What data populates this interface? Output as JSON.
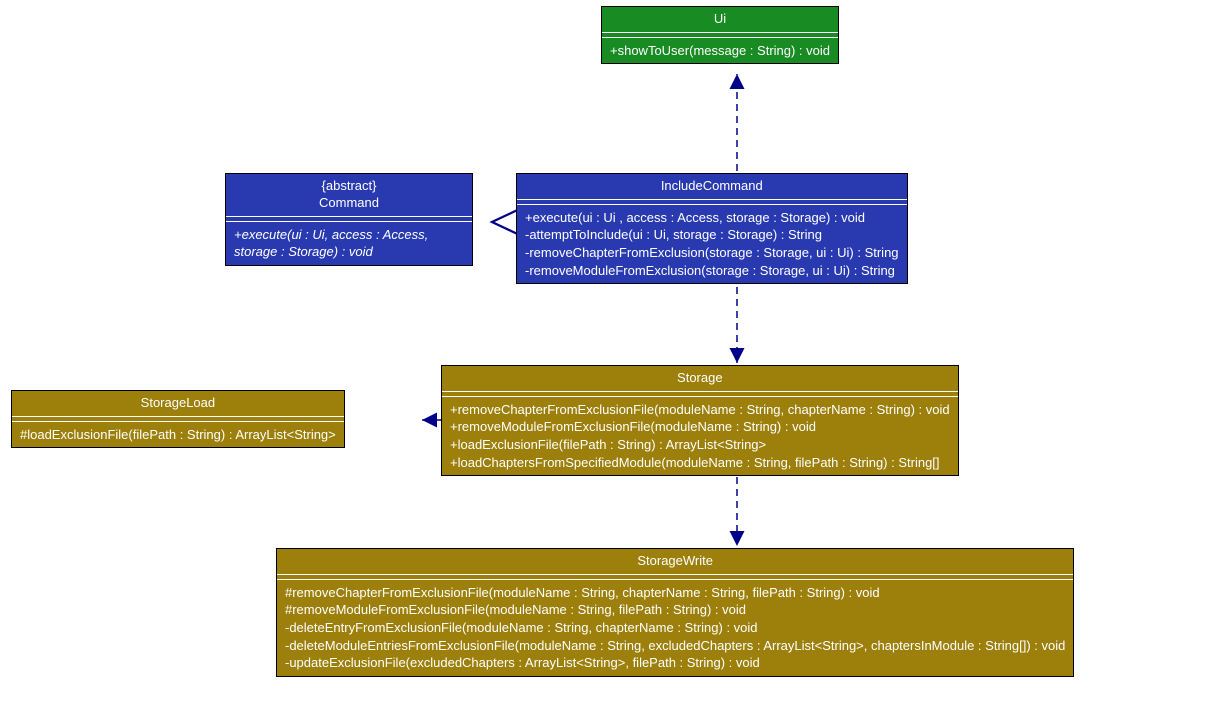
{
  "classes": {
    "ui": {
      "name": "Ui",
      "methods": [
        "+showToUser(message : String) : void"
      ]
    },
    "command": {
      "stereotype": "{abstract}",
      "name": "Command",
      "methods": [
        "+execute(ui : Ui, access : Access, storage : Storage) : void"
      ]
    },
    "includeCommand": {
      "name": "IncludeCommand",
      "methods": [
        "+execute(ui : Ui , access : Access, storage : Storage) : void",
        "-attemptToInclude(ui : Ui, storage : Storage) : String",
        "-removeChapterFromExclusion(storage : Storage, ui : Ui) : String",
        "-removeModuleFromExclusion(storage : Storage, ui : Ui) : String"
      ]
    },
    "storage": {
      "name": "Storage",
      "methods": [
        "+removeChapterFromExclusionFile(moduleName : String, chapterName : String) : void",
        "+removeModuleFromExclusionFile(moduleName : String) : void",
        "+loadExclusionFile(filePath : String) : ArrayList<String>",
        "+loadChaptersFromSpecifiedModule(moduleName : String, filePath : String) : String[]"
      ]
    },
    "storageLoad": {
      "name": "StorageLoad",
      "methods": [
        "#loadExclusionFile(filePath : String) : ArrayList<String>"
      ]
    },
    "storageWrite": {
      "name": "StorageWrite",
      "methods": [
        "#removeChapterFromExclusionFile(moduleName : String, chapterName : String, filePath : String) : void",
        "#removeModuleFromExclusionFile(moduleName : String, filePath : String) : void",
        "-deleteEntryFromExclusionFile(moduleName : String, chapterName : String) : void",
        "-deleteModuleEntriesFromExclusionFile(moduleName : String, excludedChapters : ArrayList<String>, chaptersInModule : String[]) : void",
        "-updateExclusionFile(excludedChapters : ArrayList<String>, filePath : String) : void"
      ]
    }
  }
}
